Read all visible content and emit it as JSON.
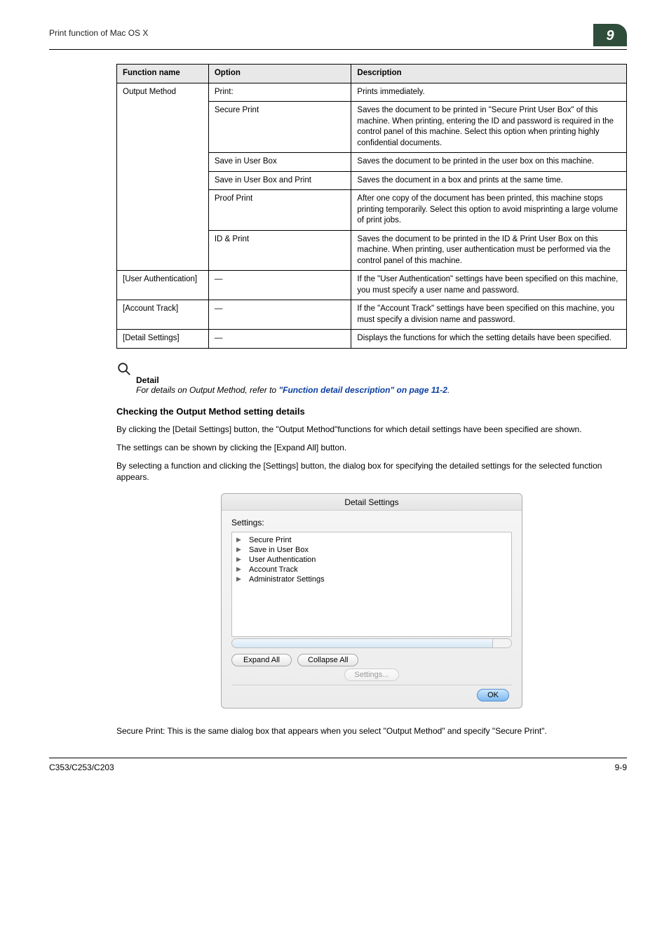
{
  "header": {
    "left": "Print function of Mac OS X",
    "chapter": "9"
  },
  "table": {
    "headers": {
      "c1": "Function name",
      "c2": "Option",
      "c3": "Description"
    },
    "rows": [
      {
        "fn": "Output Method",
        "opt": "Print:",
        "desc": "Prints immediately.",
        "span": 6,
        "first": true
      },
      {
        "opt": "Secure Print",
        "desc": "Saves the document to be printed in \"Secure Print User Box\" of this machine. When printing, entering the ID and password is required in the control panel of this machine. Select this option when printing highly confidential documents."
      },
      {
        "opt": "Save in User Box",
        "desc": "Saves the document to be printed in the user box on this machine."
      },
      {
        "opt": "Save in User Box and Print",
        "desc": "Saves the document in a box and prints at the same time."
      },
      {
        "opt": "Proof Print",
        "desc": "After one copy of the document has been printed, this machine stops printing temporarily. Select this option to avoid misprinting a large volume of print jobs."
      },
      {
        "opt": "ID & Print",
        "desc": "Saves the document to be printed in the ID & Print User Box on this machine. When printing, user authentication must be performed via the control panel of this machine."
      },
      {
        "fn": "[User Authentication]",
        "opt": "—",
        "desc": "If the \"User Authentication\" settings have been specified on this machine, you must specify a user name and password.",
        "span": 1,
        "first": true
      },
      {
        "fn": "[Account Track]",
        "opt": "—",
        "desc": "If the \"Account Track\" settings have been specified on this machine, you must specify a division name and password.",
        "span": 1,
        "first": true
      },
      {
        "fn": "[Detail Settings]",
        "opt": "—",
        "desc": "Displays the functions for which the setting details have been specified.",
        "span": 1,
        "first": true
      }
    ]
  },
  "callout": {
    "label": "Detail",
    "prefix": "For details on Output Method, refer to ",
    "link": "\"Function detail description\" on page 11-2",
    "suffix": "."
  },
  "section_heading": "Checking the Output Method setting details",
  "paras": [
    "By clicking the [Detail Settings] button, the \"Output Method\"functions for which detail settings have been specified are shown.",
    "The settings can be shown by clicking the [Expand All] button.",
    "By selecting a function and clicking the [Settings] button, the dialog box for specifying the detailed settings for the selected function appears."
  ],
  "dialog": {
    "title": "Detail Settings",
    "label": "Settings:",
    "items": [
      "Secure Print",
      "Save in User Box",
      "User Authentication",
      "Account Track",
      "Administrator Settings"
    ],
    "buttons": {
      "expand": "Expand All",
      "collapse": "Collapse All",
      "settings": "Settings...",
      "ok": "OK"
    }
  },
  "after_dialog": "Secure Print: This is the same dialog box that appears when you select \"Output Method\" and specify \"Secure Print\".",
  "footer": {
    "left": "C353/C253/C203",
    "right": "9-9"
  }
}
